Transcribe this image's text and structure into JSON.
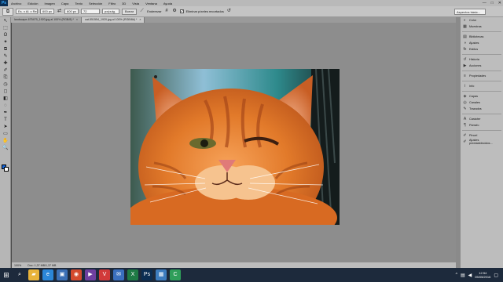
{
  "app": {
    "logo": "Ps"
  },
  "menubar": {
    "items": [
      "Archivo",
      "Edición",
      "Imagen",
      "Capa",
      "Texto",
      "Selección",
      "Filtro",
      "3D",
      "Vista",
      "Ventana",
      "Ayuda"
    ],
    "win_min": "—",
    "win_max": "□",
    "win_close": "✕"
  },
  "options": {
    "style_value": "Es. x Al. x Res.",
    "width_value": "600 px",
    "height_value": "600 px",
    "resolution_value": "72",
    "resolution_unit": "px/pulg.",
    "clear_label": "Borrar",
    "straighten_label": "Enderezar",
    "delete_pixels_label": "Eliminar píxeles recortados",
    "workspace_value": "Aspectos básic..."
  },
  "tabs": [
    {
      "label": "landscape-675479_1920.jpg al 100% (RGB/8) *",
      "close": "×"
    },
    {
      "label": "cat-551554_1920.jpg al 100% (RGB/8#) *",
      "close": "×"
    }
  ],
  "status": {
    "zoom": "100%",
    "doc": "Doc: 1,37 MB/1,37 MB"
  },
  "panels": [
    {
      "icon": "palette-icon",
      "glyph": "◐",
      "label": "Color"
    },
    {
      "icon": "swatches-icon",
      "glyph": "▦",
      "label": "Muestras"
    },
    {
      "sep": true
    },
    {
      "icon": "library-icon",
      "glyph": "▤",
      "label": "Bibliotecas"
    },
    {
      "icon": "adjustments-icon",
      "glyph": "◑",
      "label": "Ajustes"
    },
    {
      "icon": "styles-icon",
      "glyph": "fx",
      "label": "Estilos"
    },
    {
      "sep": true
    },
    {
      "icon": "history-icon",
      "glyph": "↺",
      "label": "Historia"
    },
    {
      "icon": "actions-icon",
      "glyph": "▶",
      "label": "Acciones"
    },
    {
      "sep": true
    },
    {
      "icon": "properties-icon",
      "glyph": "≡",
      "label": "Propiedades"
    },
    {
      "sep": true
    },
    {
      "icon": "info-icon",
      "glyph": "i",
      "label": "Info"
    },
    {
      "sep": true
    },
    {
      "icon": "layers-icon",
      "glyph": "◈",
      "label": "Capas"
    },
    {
      "icon": "channels-icon",
      "glyph": "◎",
      "label": "Canales"
    },
    {
      "icon": "paths-icon",
      "glyph": "✎",
      "label": "Trazados"
    },
    {
      "sep": true
    },
    {
      "icon": "character-icon",
      "glyph": "A",
      "label": "Carácter"
    },
    {
      "icon": "paragraph-icon",
      "glyph": "¶",
      "label": "Párrafo"
    },
    {
      "sep": true
    },
    {
      "icon": "brush-icon",
      "glyph": "✐",
      "label": "Pincel"
    },
    {
      "icon": "brush-presets-icon",
      "glyph": "✐",
      "label": "Ajustes preestablecidos..."
    }
  ],
  "tools": [
    "↖",
    "⬚",
    "ʘ",
    "✦",
    "⧉",
    "✎",
    "✚",
    "✐",
    "⎘",
    "◷",
    "◻",
    "◧",
    "◌",
    "✒",
    "T",
    "➤",
    "▭",
    "✋",
    "🔍"
  ],
  "taskbar": {
    "start": "⊞",
    "apps": [
      {
        "name": "search-app-icon",
        "glyph": "⌕",
        "color": "#1d2a3c"
      },
      {
        "name": "explorer-app-icon",
        "glyph": "▰",
        "color": "#e8b33a"
      },
      {
        "name": "ie-app-icon",
        "glyph": "e",
        "color": "#2b86d8"
      },
      {
        "name": "store-app-icon",
        "glyph": "▣",
        "color": "#3b6fb5"
      },
      {
        "name": "chrome-app-icon",
        "glyph": "◉",
        "color": "#d44a2e"
      },
      {
        "name": "media-app-icon",
        "glyph": "▶",
        "color": "#6f3fa0"
      },
      {
        "name": "vivaldi-app-icon",
        "glyph": "V",
        "color": "#d23a3a"
      },
      {
        "name": "mail-app-icon",
        "glyph": "✉",
        "color": "#3a6fbf"
      },
      {
        "name": "excel-app-icon",
        "glyph": "X",
        "color": "#1f7a45"
      },
      {
        "name": "ps-app-icon",
        "glyph": "Ps",
        "color": "#0b2d52"
      },
      {
        "name": "app-icon",
        "glyph": "▦",
        "color": "#3d7dbf"
      },
      {
        "name": "camtasia-app-icon",
        "glyph": "C",
        "color": "#2f9e5a"
      }
    ],
    "time": "12:54",
    "date": "05/05/2016"
  }
}
